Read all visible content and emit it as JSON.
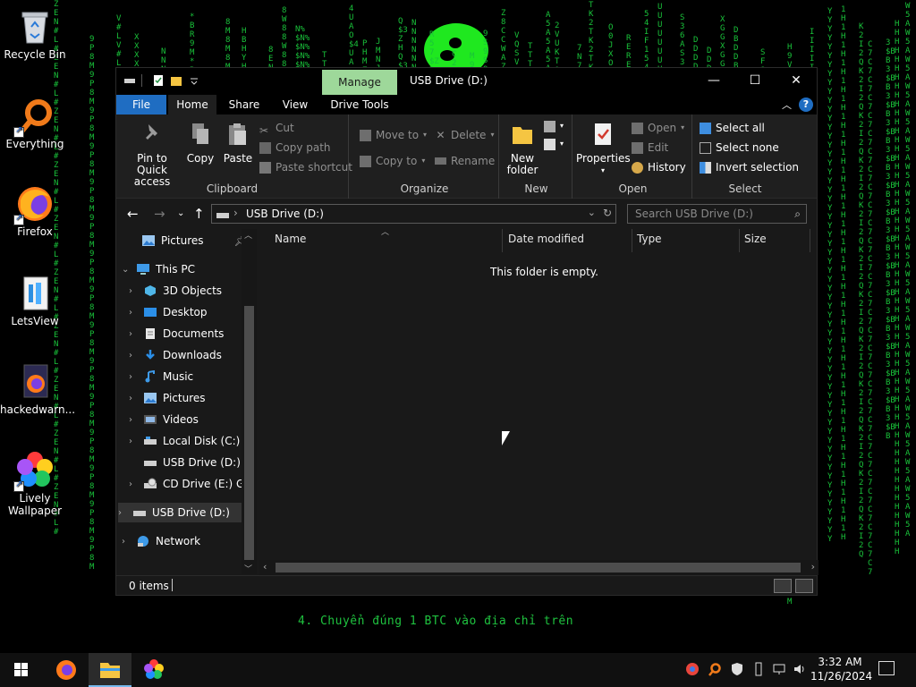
{
  "desktop": {
    "icons": [
      {
        "label": "Recycle Bin",
        "icon": "recycle-bin-icon"
      },
      {
        "label": "Everything",
        "icon": "everything-search-icon"
      },
      {
        "label": "Firefox",
        "icon": "firefox-icon"
      },
      {
        "label": "LetsView",
        "icon": "letsview-icon"
      },
      {
        "label": "hackedwarn...",
        "icon": "html-file-icon"
      },
      {
        "label": "Lively\nWallpaper",
        "icon": "lively-wallpaper-icon"
      }
    ],
    "matrix_message": "4. Chuyển đúng 1 BTC vào địa chỉ trên",
    "matrix_columns": [
      "ZEN#L#",
      "X",
      "*BR9M",
      "8ENA",
      "N%$",
      "4UAO$",
      "JMNJ",
      "Q$3ZH",
      "C2$MHA",
      "9S",
      "Z8CCWA",
      "T",
      "2VUKTO",
      "TK2",
      "RE",
      "S36A",
      "D",
      "DBD",
      "1H",
      "3$BB",
      "8M",
      "T",
      "R57$Z",
      "54IF1",
      "H9V1C1M",
      "K2I2Q",
      "W5A",
      "9P8M",
      "V#L",
      "N",
      "HBHY",
      "8W8",
      "PHMZ",
      "N",
      "M9F",
      "VQS",
      "A5",
      "7N",
      "O0JX",
      "U",
      "D",
      "XGG",
      "SF8",
      "I",
      "Y",
      "C7",
      "H"
    ]
  },
  "window": {
    "title": "USB Drive (D:)",
    "manage_tab": "Manage",
    "tabs": {
      "file": "File",
      "home": "Home",
      "share": "Share",
      "view": "View",
      "drive_tools": "Drive Tools"
    },
    "ribbon": {
      "clipboard": {
        "label": "Clipboard",
        "pin": "Pin to Quick\naccess",
        "copy": "Copy",
        "paste": "Paste",
        "cut": "Cut",
        "copy_path": "Copy path",
        "paste_shortcut": "Paste shortcut"
      },
      "organize": {
        "label": "Organize",
        "move_to": "Move to",
        "copy_to": "Copy to",
        "delete": "Delete",
        "rename": "Rename"
      },
      "new": {
        "label": "New",
        "new_folder": "New\nfolder"
      },
      "open": {
        "label": "Open",
        "properties": "Properties",
        "open": "Open",
        "edit": "Edit",
        "history": "History"
      },
      "select": {
        "label": "Select",
        "select_all": "Select all",
        "select_none": "Select none",
        "invert": "Invert selection"
      }
    },
    "address": {
      "path": "USB Drive (D:)",
      "search_placeholder": "Search USB Drive (D:)"
    },
    "nav_pane": {
      "quick": [
        {
          "label": "Pictures"
        }
      ],
      "this_pc": "This PC",
      "pc_items": [
        {
          "label": "3D Objects"
        },
        {
          "label": "Desktop"
        },
        {
          "label": "Documents"
        },
        {
          "label": "Downloads"
        },
        {
          "label": "Music"
        },
        {
          "label": "Pictures"
        },
        {
          "label": "Videos"
        },
        {
          "label": "Local Disk (C:)"
        },
        {
          "label": "USB Drive (D:)"
        },
        {
          "label": "CD Drive (E:) GPa"
        }
      ],
      "usb_root": "USB Drive (D:)",
      "network": "Network"
    },
    "columns": {
      "name": "Name",
      "date": "Date modified",
      "type": "Type",
      "size": "Size"
    },
    "empty_message": "This folder is empty.",
    "status": "0 items"
  },
  "taskbar": {
    "apps": [
      {
        "name": "firefox-icon"
      },
      {
        "name": "file-explorer-icon",
        "active": true
      },
      {
        "name": "lively-wallpaper-icon"
      }
    ],
    "clock_time": "3:32 AM",
    "clock_date": "11/26/2024"
  },
  "colors": {
    "matrix_green": "#19c23a",
    "accent_blue": "#1f6dc2",
    "manage_green": "#9ed89a",
    "window_bg": "#191919"
  }
}
